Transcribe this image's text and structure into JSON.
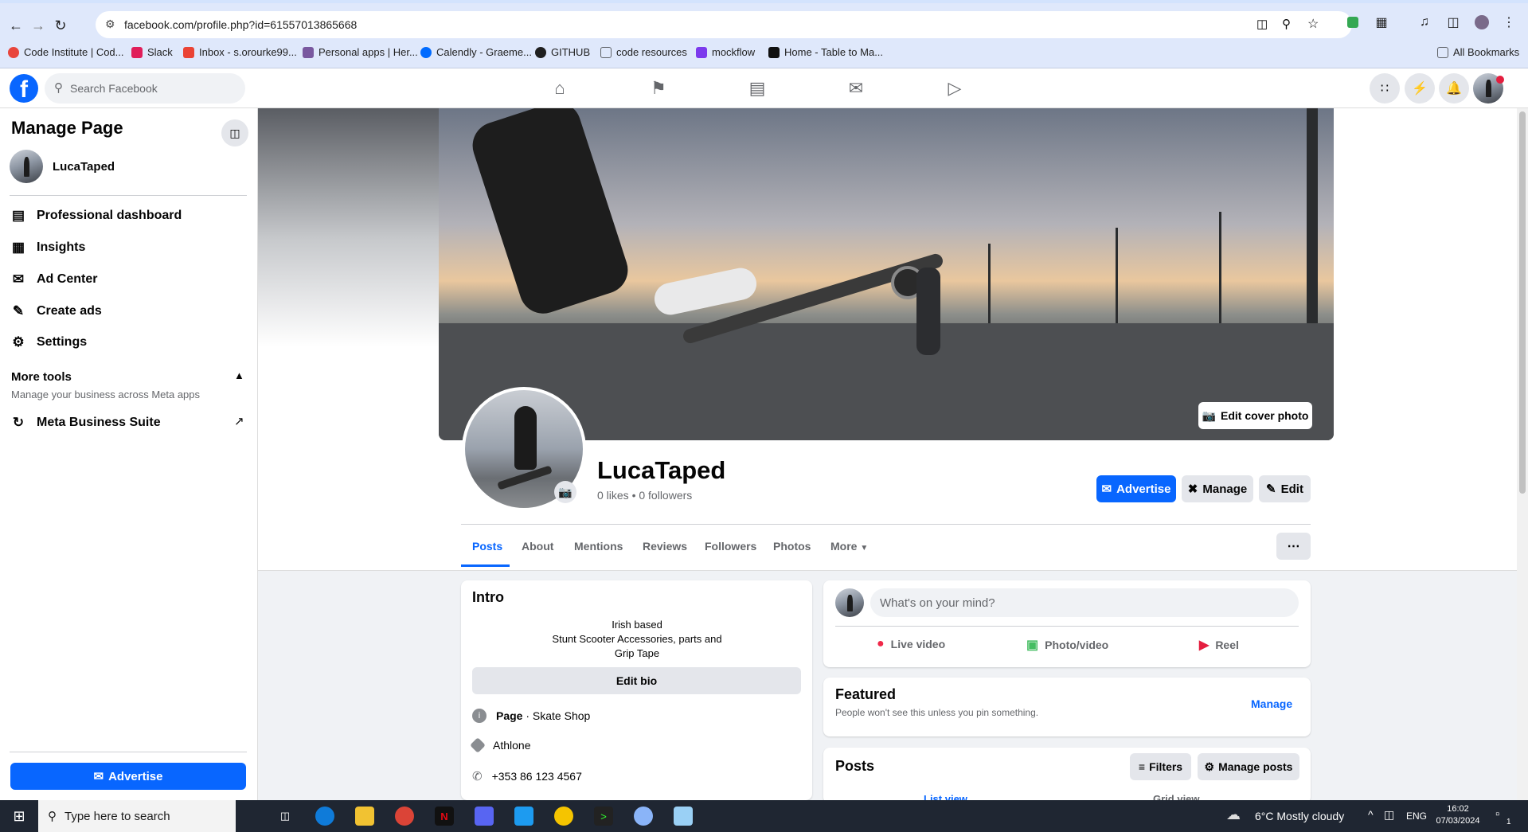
{
  "browser": {
    "url": "facebook.com/profile.php?id=61557013865668",
    "bookmarks": [
      {
        "label": "Code Institute | Cod...",
        "color": "#e8453c"
      },
      {
        "label": "Slack",
        "color": "#4a154b"
      },
      {
        "label": "Inbox - s.orourke99...",
        "color": "#ea4335"
      },
      {
        "label": "Personal apps | Her...",
        "color": "#79589f"
      },
      {
        "label": "Calendly - Graeme...",
        "color": "#006bff"
      },
      {
        "label": "GITHUB",
        "color": "#1f1f1f"
      },
      {
        "label": "code resources",
        "color": "#5f6368"
      },
      {
        "label": "mockflow",
        "color": "#7c3aed"
      },
      {
        "label": "Home - Table to Ma...",
        "color": "#111111"
      }
    ],
    "all_bookmarks": "All Bookmarks"
  },
  "fb": {
    "search_placeholder": "Search Facebook"
  },
  "sidebar": {
    "title": "Manage Page",
    "page_name": "LucaTaped",
    "items": [
      {
        "label": "Professional dashboard",
        "icon": "dashboard-icon"
      },
      {
        "label": "Insights",
        "icon": "insights-icon"
      },
      {
        "label": "Ad Center",
        "icon": "megaphone-icon"
      },
      {
        "label": "Create ads",
        "icon": "pencil-icon"
      },
      {
        "label": "Settings",
        "icon": "gear-icon"
      }
    ],
    "more_tools": "More tools",
    "more_tools_sub": "Manage your business across Meta apps",
    "meta_business": "Meta Business Suite",
    "advertise": "Advertise"
  },
  "profile": {
    "edit_cover": "Edit cover photo",
    "name": "LucaTaped",
    "stats": "0 likes • 0 followers",
    "advertise": "Advertise",
    "manage": "Manage",
    "edit": "Edit",
    "tabs": [
      "Posts",
      "About",
      "Mentions",
      "Reviews",
      "Followers",
      "Photos",
      "More"
    ]
  },
  "intro": {
    "title": "Intro",
    "bio_lines": [
      "Irish based",
      "Stunt Scooter Accessories, parts and",
      "Grip Tape"
    ],
    "edit_bio": "Edit bio",
    "page_label": "Page",
    "category": " · Skate Shop",
    "location": "Athlone",
    "phone": "+353 86 123 4567"
  },
  "composer": {
    "placeholder": "What's on your mind?",
    "live": "Live video",
    "photo": "Photo/video",
    "reel": "Reel"
  },
  "featured": {
    "title": "Featured",
    "sub": "People won't see this unless you pin something.",
    "manage": "Manage"
  },
  "posts": {
    "title": "Posts",
    "filters": "Filters",
    "manage_posts": "Manage posts",
    "list_view": "List view",
    "grid_view": "Grid view"
  },
  "taskbar": {
    "search": "Type here to search",
    "weather": "6°C  Mostly cloudy",
    "lang": "ENG",
    "time": "16:02",
    "date": "07/03/2024",
    "notif_count": "1"
  },
  "colors": {
    "fb_blue": "#0866ff",
    "reel_red": "#e41e3f",
    "photo_green": "#45bd62",
    "live_red": "#f02849"
  }
}
